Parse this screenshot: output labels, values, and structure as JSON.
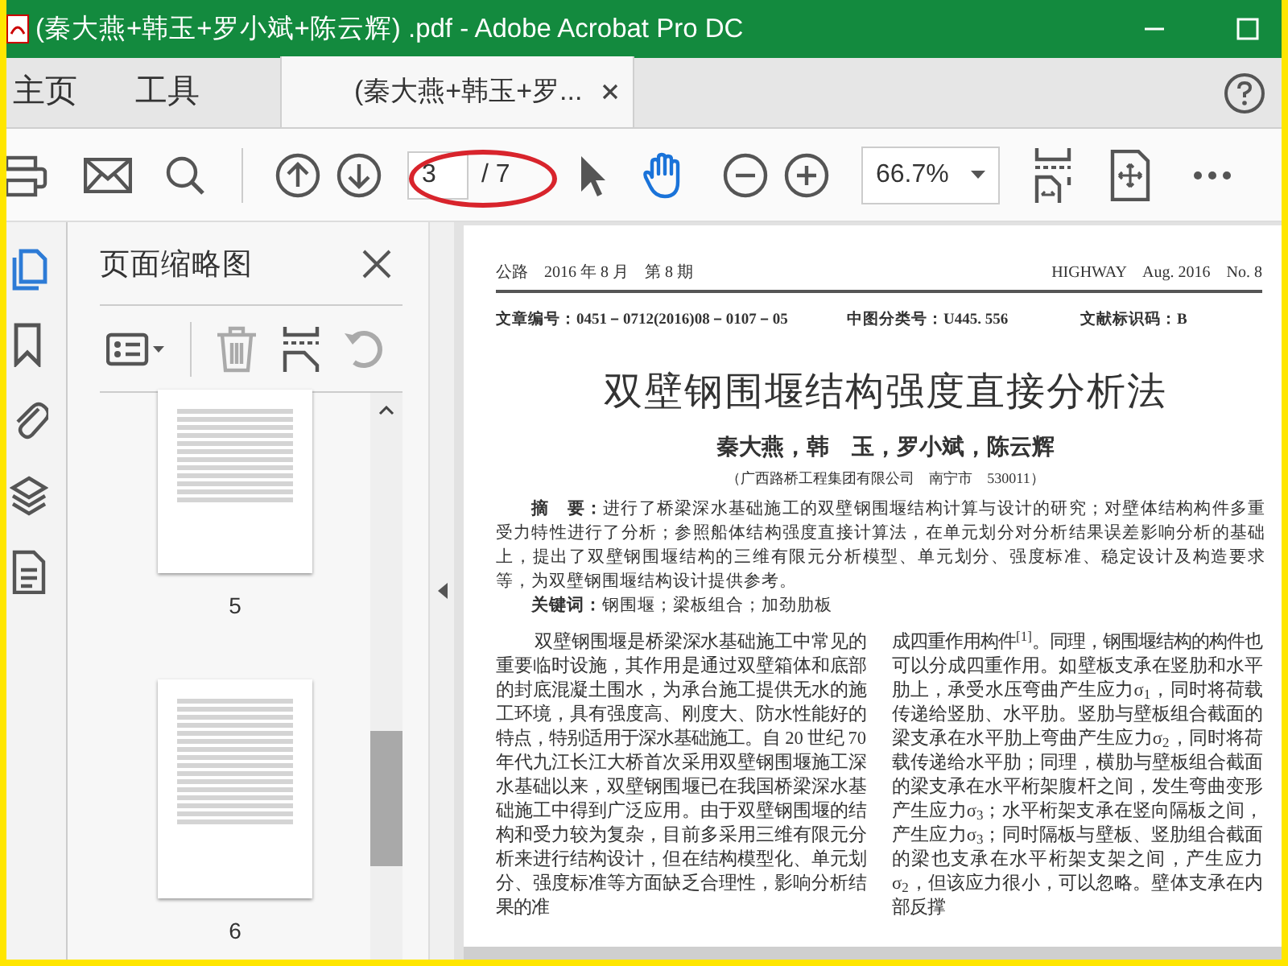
{
  "window": {
    "title": "(秦大燕+韩玉+罗小斌+陈云辉) .pdf - Adobe Acrobat Pro DC"
  },
  "nav_tabs": [
    {
      "label": "主页",
      "selected": false
    },
    {
      "label": "工具",
      "selected": false
    }
  ],
  "document_tab": {
    "label": "(秦大燕+韩玉+罗...",
    "selected": true
  },
  "toolbar": {
    "page_current": "3",
    "page_total": "/ 7",
    "zoom": "66.7%",
    "tools": [
      {
        "kind": "select",
        "selected": false
      },
      {
        "kind": "hand",
        "selected": true
      }
    ]
  },
  "sidebar": {
    "rail": [
      {
        "kind": "pages",
        "selected": true
      },
      {
        "kind": "bookmarks",
        "selected": false
      },
      {
        "kind": "attachments",
        "selected": false
      },
      {
        "kind": "layers",
        "selected": false
      },
      {
        "kind": "content",
        "selected": false
      }
    ],
    "panel": {
      "title": "页面缩略图",
      "thumbnails": [
        {
          "label": "5"
        },
        {
          "label": "6"
        }
      ]
    }
  },
  "document": {
    "header_left": "公路　2016 年 8 月　第 8 期",
    "header_right": "HIGHWAY　Aug. 2016　No. 8",
    "meta": [
      "文章编号：0451－0712(2016)08－0107－05",
      "中图分类号：U445. 556",
      "文献标识码：B"
    ],
    "title": "双壁钢围堰结构强度直接分析法",
    "authors": "秦大燕，韩　玉，罗小斌，陈云辉",
    "affiliation": "（广西路桥工程集团有限公司　南宁市　530011）",
    "abstract": "**摘　要：**进行了桥梁深水基础施工的双壁钢围堰结构计算与设计的研究；对壁体结构构件多重受力特性进行了分析；参照船体结构强度直接计算法，在单元划分对分析结果误差影响分析的基础上，提出了双壁钢围堰结构的三维有限元分析模型、单元划分、强度标准、稳定设计及构造要求等，为双壁钢围堰结构设计提供参考。",
    "keywords": "**关键词：**钢围堰；梁板组合；加劲肋板",
    "columns": [
      "双壁钢围堰是桥梁深水基础施工中常见的重要临时设施，其作用是通过双壁箱体和底部的封底混凝土围水，为承台施工提供无水的施工环境，具有强度高、刚度大、防水性能好的特点，特别适用于深水基础施工。自 20 世纪 70 年代九江长江大桥首次采用双壁钢围堰施工深水基础以来，双壁钢围堰已在我国桥梁深水基础施工中得到广泛应用。由于双壁钢围堰的结构和受力较为复杂，目前多采用三维有限元分析来进行结构设计，但在结构模型化、单元划分、强度标准等方面缺乏合理性，影响分析结果的准",
      "成四重作用构件$^{[1]}$。同理，钢围堰结构的构件也可以分成四重作用。如壁板支承在竖肋和水平肋上，承受水压弯曲产生应力σ$_{1}$，同时将荷载传递给竖肋、水平肋。竖肋与壁板组合截面的梁支承在水平肋上弯曲产生应力σ$_{2}$，同时将荷载传递给水平肋；同理，横肋与壁板组合截面的梁支承在水平桁架腹杆之间，发生弯曲变形产生应力σ$_{3}$；水平桁架支承在竖向隔板之间，产生应力σ$_{3}$；同时隔板与壁板、竖肋组合截面的梁也支承在水平桁架支架之间，产生应力σ$_{2}$，但该应力很小，可以忽略。壁体支承在内部反撑"
    ]
  }
}
